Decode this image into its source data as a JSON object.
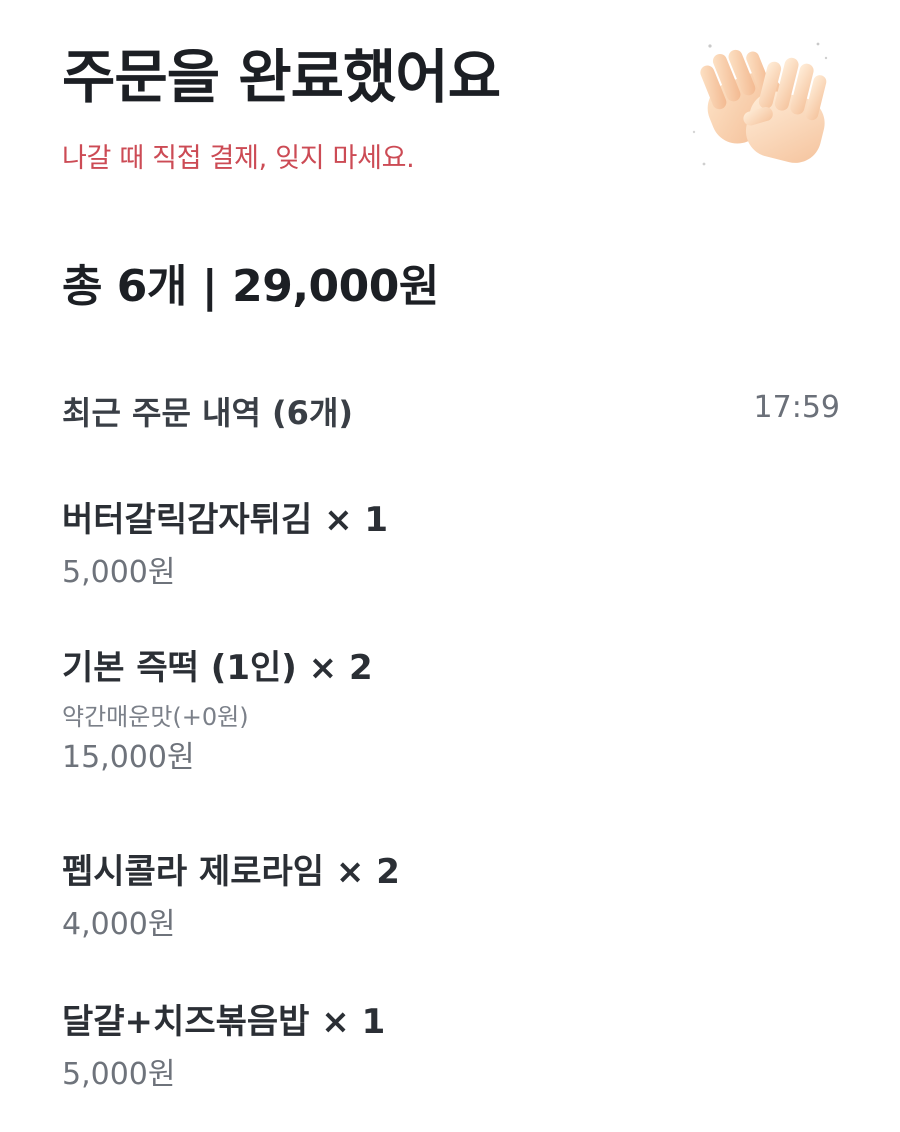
{
  "header": {
    "title": "주문을 완료했어요",
    "subtitle": "나갈 때 직접 결제, 잊지 마세요.",
    "icon": "clapping-hands-icon"
  },
  "summary": {
    "total_text": "총 6개 | 29,000원"
  },
  "history": {
    "title": "최근 주문 내역 (6개)",
    "time": "17:59"
  },
  "items": [
    {
      "name": "버터갈릭감자튀김 × 1",
      "option": "",
      "price": "5,000원"
    },
    {
      "name": "기본 즉떡 (1인) × 2",
      "option": "약간매운맛(+0원)",
      "price": "15,000원"
    },
    {
      "name": "펩시콜라 제로라임 × 2",
      "option": "",
      "price": "4,000원"
    },
    {
      "name": "달걀+치즈볶음밥 × 1",
      "option": "",
      "price": "5,000원"
    }
  ],
  "colors": {
    "accent": "#cc4b55",
    "text_primary": "#1c1f24",
    "text_secondary": "#6e737b"
  }
}
